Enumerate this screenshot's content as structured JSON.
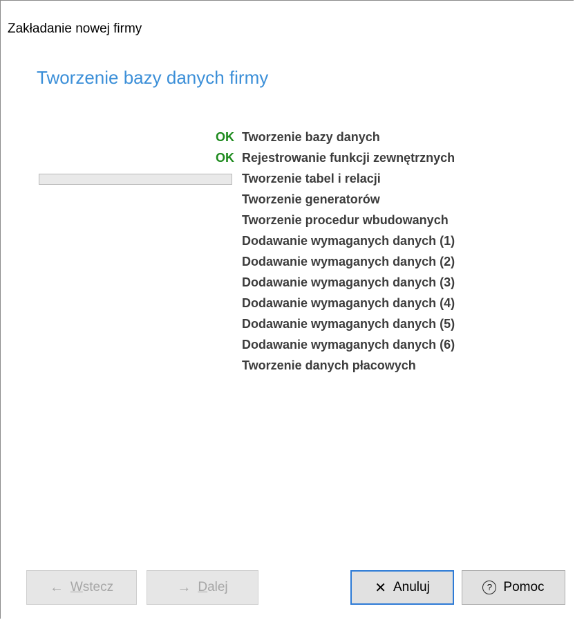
{
  "window": {
    "title": "Zakładanie nowej firmy"
  },
  "heading": "Tworzenie bazy danych firmy",
  "steps": [
    {
      "status": "OK",
      "label": "Tworzenie bazy danych"
    },
    {
      "status": "OK",
      "label": "Rejestrowanie funkcji zewnętrznych"
    },
    {
      "status": "",
      "label": "Tworzenie tabel i relacji",
      "progress": 0
    },
    {
      "status": "",
      "label": "Tworzenie generatorów"
    },
    {
      "status": "",
      "label": "Tworzenie procedur wbudowanych"
    },
    {
      "status": "",
      "label": "Dodawanie wymaganych danych (1)"
    },
    {
      "status": "",
      "label": "Dodawanie wymaganych danych (2)"
    },
    {
      "status": "",
      "label": "Dodawanie wymaganych danych (3)"
    },
    {
      "status": "",
      "label": "Dodawanie wymaganych danych (4)"
    },
    {
      "status": "",
      "label": "Dodawanie wymaganych danych (5)"
    },
    {
      "status": "",
      "label": "Dodawanie wymaganych danych (6)"
    },
    {
      "status": "",
      "label": "Tworzenie danych płacowych"
    }
  ],
  "buttons": {
    "back": {
      "accel": "W",
      "rest": "stecz",
      "icon": "arrow-left-icon",
      "enabled": false
    },
    "next": {
      "accel": "D",
      "rest": "alej",
      "icon": "arrow-right-icon",
      "enabled": false
    },
    "cancel": {
      "label": "Anuluj",
      "icon": "close-icon",
      "enabled": true
    },
    "help": {
      "label": "Pomoc",
      "icon": "help-icon",
      "enabled": true
    }
  },
  "colors": {
    "accent": "#3b8fd8",
    "ok": "#1d8a1d",
    "default_border": "#2e7bd6"
  }
}
